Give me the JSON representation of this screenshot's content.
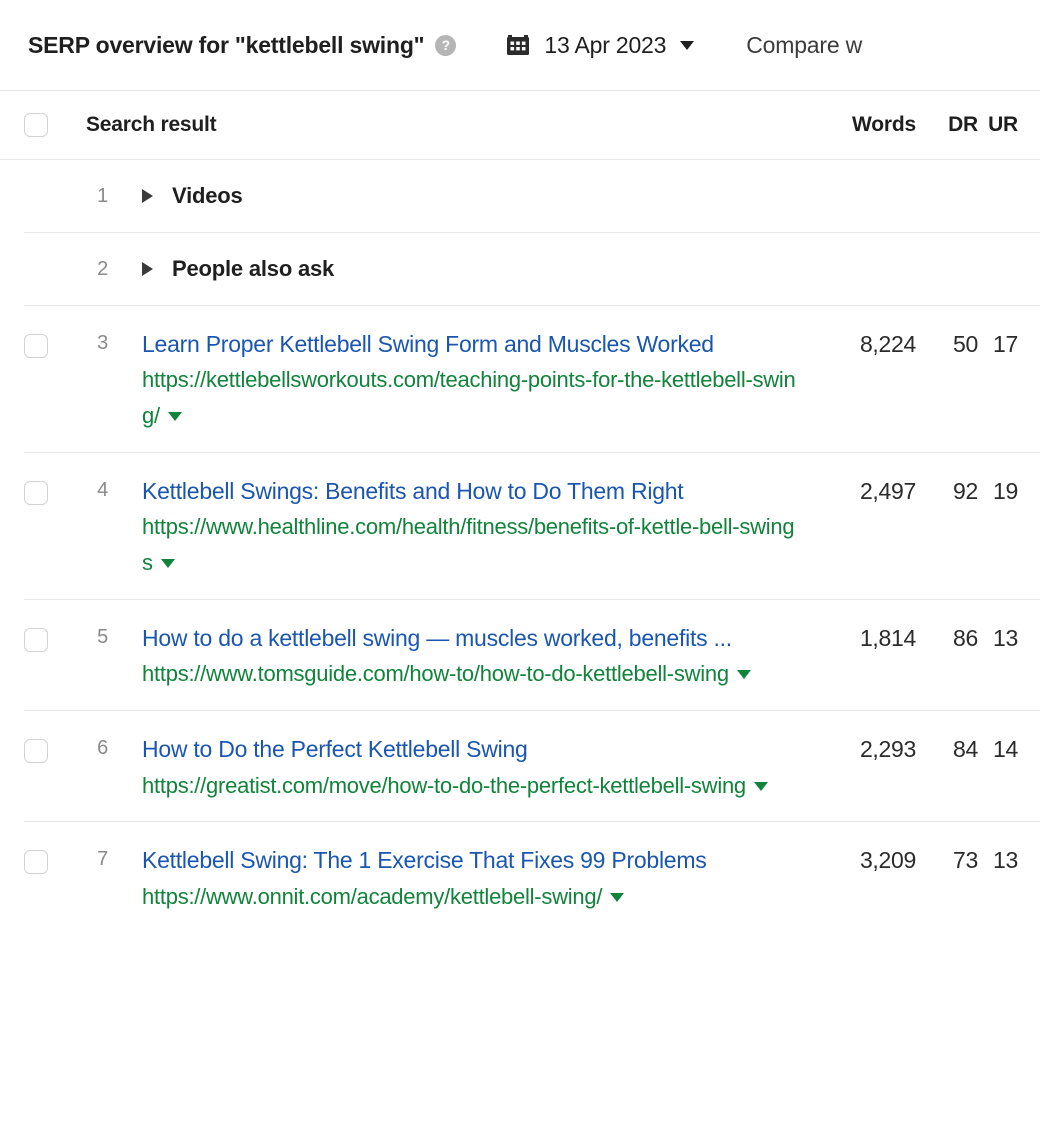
{
  "header": {
    "title": "SERP overview for \"kettlebell swing\"",
    "help_icon": "help-circle-icon",
    "calendar_icon": "calendar-icon",
    "date": "13 Apr 2023",
    "date_caret": "chevron-down-icon",
    "compare_label": "Compare w"
  },
  "table": {
    "columns": {
      "select_all": "select-all-checkbox",
      "search_result": "Search result",
      "words": "Words",
      "dr": "DR",
      "ur": "UR"
    },
    "rows": [
      {
        "type": "feature",
        "rank": "1",
        "label": "Videos",
        "expand_icon": "caret-right-icon"
      },
      {
        "type": "feature",
        "rank": "2",
        "label": "People also ask",
        "expand_icon": "caret-right-icon"
      },
      {
        "type": "result",
        "rank": "3",
        "title": "Learn Proper Kettlebell Swing Form and Muscles Worked",
        "url": "https://kettlebellsworkouts.com/teaching-points-for-the-kettlebell-swing/",
        "words": "8,224",
        "dr": "50",
        "ur": "17"
      },
      {
        "type": "result",
        "rank": "4",
        "title": "Kettlebell Swings: Benefits and How to Do Them Right",
        "url": "https://www.healthline.com/health/fitness/benefits-of-kettle-bell-swings",
        "words": "2,497",
        "dr": "92",
        "ur": "19"
      },
      {
        "type": "result",
        "rank": "5",
        "title": "How to do a kettlebell swing — muscles worked, benefits ...",
        "url": "https://www.tomsguide.com/how-to/how-to-do-kettlebell-swing",
        "words": "1,814",
        "dr": "86",
        "ur": "13"
      },
      {
        "type": "result",
        "rank": "6",
        "title": "How to Do the Perfect Kettlebell Swing",
        "url": "https://greatist.com/move/how-to-do-the-perfect-kettlebell-swing",
        "words": "2,293",
        "dr": "84",
        "ur": "14"
      },
      {
        "type": "result",
        "rank": "7",
        "title": "Kettlebell Swing: The 1 Exercise That Fixes 99 Problems",
        "url": "https://www.onnit.com/academy/kettlebell-swing/",
        "words": "3,209",
        "dr": "73",
        "ur": "13"
      }
    ]
  },
  "colors": {
    "link_blue": "#1a56b0",
    "url_green": "#12833b",
    "text_dark": "#1f1f1f",
    "rank_gray": "#8a8a8a",
    "divider": "#e6e6e6"
  }
}
